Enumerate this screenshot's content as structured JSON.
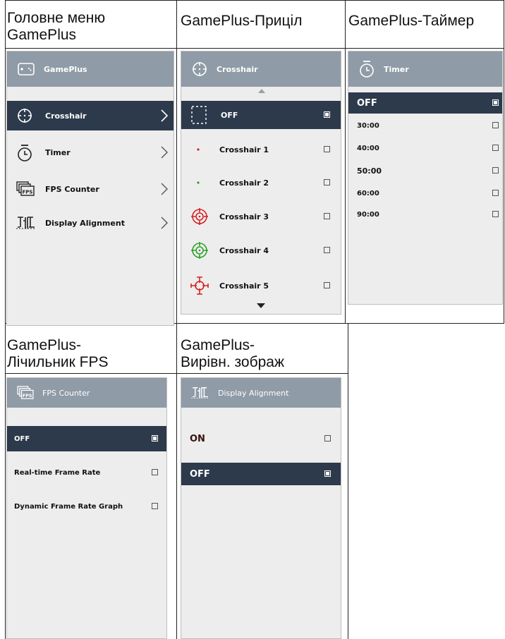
{
  "captions": {
    "main": "Головне меню\nGamePlus",
    "crosshair": "GamePlus-Приціл",
    "timer": "GamePlus-Таймер",
    "fps": "GamePlus-\nЛічильник FPS",
    "align": "GamePlus-\nВирівн. зображ"
  },
  "main_menu": {
    "header": "GamePlus",
    "header_icon": "gamepad-icon",
    "items": [
      {
        "label": "Crosshair",
        "icon": "crosshair-icon",
        "selected": true
      },
      {
        "label": "Timer",
        "icon": "timer-icon",
        "selected": false
      },
      {
        "label": "FPS Counter",
        "icon": "fps-icon",
        "selected": false
      },
      {
        "label": "Display Alignment",
        "icon": "alignment-icon",
        "selected": false
      }
    ]
  },
  "crosshair_menu": {
    "header": "Crosshair",
    "items": [
      {
        "label": "OFF",
        "selected": true,
        "checked": true
      },
      {
        "label": "Crosshair 1",
        "selected": false,
        "checked": false
      },
      {
        "label": "Crosshair 2",
        "selected": false,
        "checked": false
      },
      {
        "label": "Crosshair 3",
        "selected": false,
        "checked": false
      },
      {
        "label": "Crosshair 4",
        "selected": false,
        "checked": false
      },
      {
        "label": "Crosshair 5",
        "selected": false,
        "checked": false
      }
    ]
  },
  "timer_menu": {
    "header": "Timer",
    "items": [
      {
        "label": "OFF",
        "selected": true,
        "checked": true
      },
      {
        "label": "30:00",
        "selected": false,
        "checked": false
      },
      {
        "label": "40:00",
        "selected": false,
        "checked": false
      },
      {
        "label": "50:00",
        "selected": false,
        "checked": false
      },
      {
        "label": "60:00",
        "selected": false,
        "checked": false
      },
      {
        "label": "90:00",
        "selected": false,
        "checked": false
      }
    ]
  },
  "fps_menu": {
    "header": "FPS Counter",
    "items": [
      {
        "label": "OFF",
        "selected": true,
        "checked": true
      },
      {
        "label": "Real-time Frame Rate",
        "selected": false,
        "checked": false
      },
      {
        "label": "Dynamic Frame Rate Graph",
        "selected": false,
        "checked": false
      }
    ]
  },
  "align_menu": {
    "header": "Display Alignment",
    "items": [
      {
        "label": "ON",
        "selected": false,
        "checked": false
      },
      {
        "label": "OFF",
        "selected": true,
        "checked": true
      }
    ]
  },
  "colors": {
    "header_bg": "#8f9ba6",
    "selected_bg": "#2d3a4c",
    "panel_bg": "#ededed",
    "crosshair_red": "#d62020",
    "crosshair_green": "#2aa12a"
  }
}
